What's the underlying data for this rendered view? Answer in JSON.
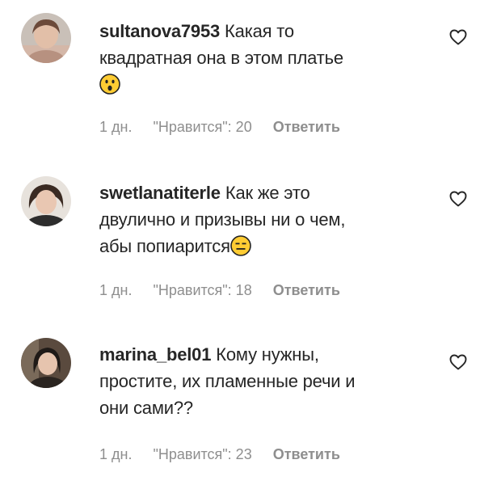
{
  "comments": [
    {
      "username": "sultanova7953",
      "text_line1": "Какая то",
      "text_line2": "квадратная она в этом платье",
      "emoji": "surprised-face-emoji",
      "time": "1 дн.",
      "likes": "\"Нравится\": 20",
      "reply": "Ответить"
    },
    {
      "username": "swetlanatiterle",
      "text_line1": "Как же это",
      "text_line2": "двулично и призывы ни о чем,",
      "text_line3": "абы попиарится",
      "emoji": "expressionless-face-emoji",
      "time": "1 дн.",
      "likes": "\"Нравится\": 18",
      "reply": "Ответить"
    },
    {
      "username": "marina_bel01",
      "text_line1": "Кому нужны,",
      "text_line2": "простите, их пламенные речи и",
      "text_line3": "они сами??",
      "time": "1 дн.",
      "likes": "\"Нравится\": 23",
      "reply": "Ответить"
    }
  ],
  "icons": {
    "like": "heart-outline-icon"
  },
  "colors": {
    "text": "#262626",
    "meta": "#8e8e8e",
    "emoji_yellow": "#ffcc33"
  }
}
